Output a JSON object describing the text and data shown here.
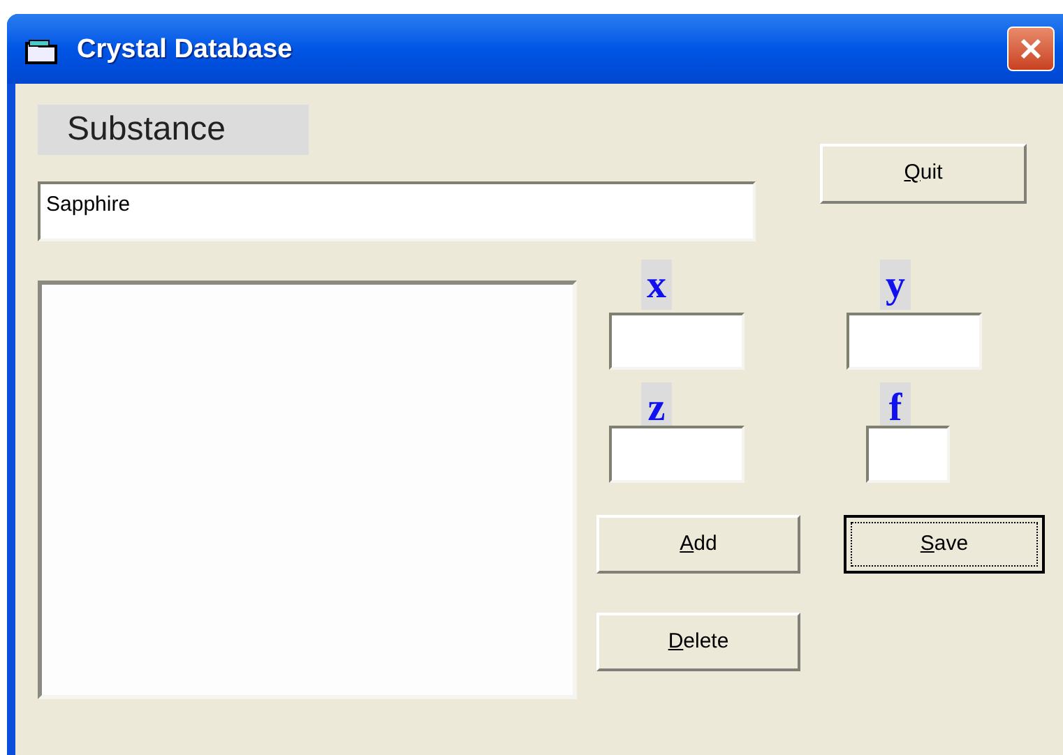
{
  "window": {
    "title": "Crystal Database"
  },
  "substance": {
    "label": "Substance",
    "value": "Sapphire"
  },
  "quit_button": {
    "label": "Quit",
    "access_key_underlined": true,
    "default": false
  },
  "coordinates": [
    {
      "label": "x"
    },
    {
      "label": "y"
    },
    {
      "label": "z"
    },
    {
      "label": "f"
    }
  ],
  "buttons": [
    {
      "label": "Add",
      "access_key_underlined": true,
      "default": false
    },
    {
      "label": "Save",
      "access_key_underlined": true,
      "default": true
    },
    {
      "label": "Delete",
      "access_key_underlined": true,
      "default": false
    }
  ]
}
